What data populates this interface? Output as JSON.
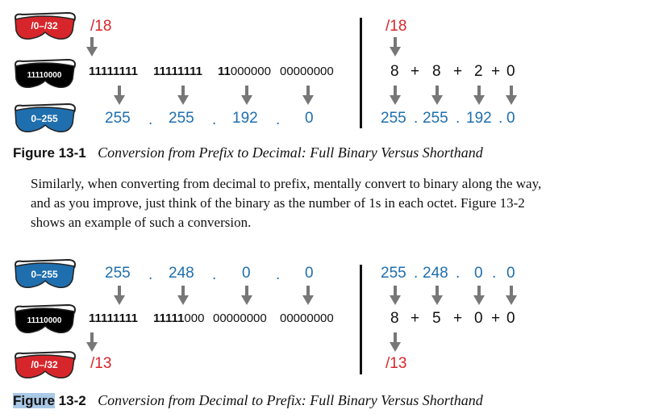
{
  "icons": {
    "prefix": {
      "name": "prefix-goggles-icon",
      "text": "/0–/32",
      "color": "#d7262b"
    },
    "binary": {
      "name": "binary-goggles-icon",
      "text": "11110000",
      "color": "#111111"
    },
    "decimal": {
      "name": "decimal-goggles-icon",
      "text": "0–255",
      "color": "#1f6fae"
    }
  },
  "figure1": {
    "prefix_left": "/18",
    "prefix_right": "/18",
    "binary_octets": [
      {
        "ones": "11111111",
        "zeros": ""
      },
      {
        "ones": "11111111",
        "zeros": ""
      },
      {
        "ones": "11",
        "zeros": "000000"
      },
      {
        "ones": "",
        "zeros": "00000000"
      }
    ],
    "decimal_left": [
      "255",
      "255",
      "192",
      "0"
    ],
    "sum_right": [
      "8",
      "+",
      "8",
      "+",
      "2",
      "+",
      "0"
    ],
    "decimal_right": [
      "255",
      ".",
      "255",
      ".",
      "192",
      ".",
      "0"
    ],
    "dot": ".",
    "caption_label": "Figure 13-1",
    "caption_title": "Conversion from Prefix to Decimal: Full Binary Versus Shorthand"
  },
  "paragraph": [
    "Similarly, when converting from decimal to prefix, mentally convert to binary along the way,",
    "and as you improve, just think of the binary as the number of 1s in each octet. Figure 13-2",
    "shows an example of such a conversion."
  ],
  "figure2": {
    "decimal_left": [
      "255",
      "248",
      "0",
      "0"
    ],
    "decimal_right": [
      "255",
      ".",
      "248",
      ".",
      "0",
      ".",
      "0"
    ],
    "binary_octets": [
      {
        "ones": "11111111",
        "zeros": ""
      },
      {
        "ones": "11111",
        "zeros": "000"
      },
      {
        "ones": "",
        "zeros": "00000000"
      },
      {
        "ones": "",
        "zeros": "00000000"
      }
    ],
    "sum_right": [
      "8",
      "+",
      "5",
      "+",
      "0",
      "+",
      "0"
    ],
    "prefix_left": "/13",
    "prefix_right": "/13",
    "dot": ".",
    "caption_label_highlight": "Figure",
    "caption_label_rest": " 13-2",
    "caption_title": "Conversion from Decimal to Prefix: Full Binary Versus Shorthand",
    "highlight_color": "#a9c9e6"
  }
}
